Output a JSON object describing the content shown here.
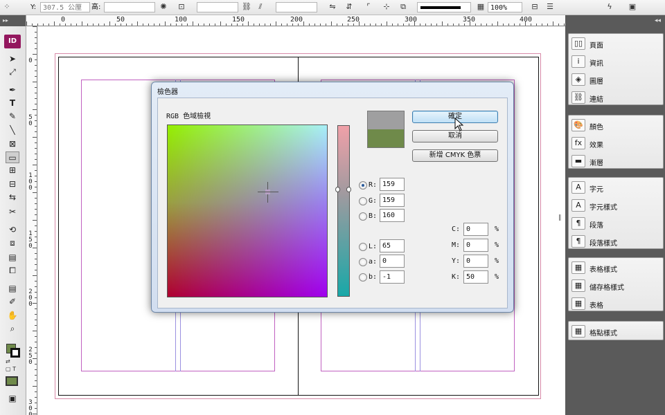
{
  "control_bar": {
    "y_label": "Y:",
    "y_value": "307.5 公厘",
    "height_label": "高:",
    "zoom_value": "100%"
  },
  "tools": {
    "app_badge": "ID",
    "items": [
      "▸",
      "↖",
      "✒",
      "T",
      "╱",
      "＼",
      "⊠",
      "▭",
      "⊞",
      "⊞",
      "⇄",
      "✂",
      "⟲",
      "⬚",
      "▦",
      "▢",
      "✎",
      "✐",
      "✋",
      "🔍"
    ],
    "selected_index": 7
  },
  "ruler": {
    "top_labels": [
      "0",
      "50",
      "100",
      "150",
      "200",
      "250",
      "300",
      "350",
      "400"
    ],
    "left_labels": [
      "0",
      "50",
      "100",
      "150",
      "200",
      "250",
      "300"
    ]
  },
  "panel": {
    "group1": [
      "頁面",
      "資訊",
      "圖層",
      "連結"
    ],
    "group2": [
      "顏色",
      "效果",
      "漸層"
    ],
    "group3": [
      "字元",
      "字元樣式",
      "段落",
      "段落樣式"
    ],
    "group4": [
      "表格樣式",
      "儲存格樣式",
      "表格"
    ],
    "group5": [
      "格點樣式"
    ],
    "icons": {
      "group1": [
        "pages-icon",
        "info-icon",
        "layers-icon",
        "links-icon"
      ],
      "group2": [
        "color-icon",
        "effects-icon",
        "gradient-icon"
      ],
      "group3": [
        "character-icon",
        "character-styles-icon",
        "paragraph-icon",
        "paragraph-styles-icon"
      ],
      "group4": [
        "table-styles-icon",
        "cell-styles-icon",
        "table-icon"
      ],
      "group5": [
        "grid-styles-icon"
      ]
    },
    "glyphs": {
      "group1": [
        "▯▯",
        "i",
        "◈",
        "⛓"
      ],
      "group2": [
        "🎨",
        "fx",
        "▬"
      ],
      "group3": [
        "A",
        "A",
        "¶",
        "¶"
      ],
      "group4": [
        "▦",
        "▦",
        "▦"
      ],
      "group5": [
        "▦"
      ]
    }
  },
  "dialog": {
    "title": "檢色器",
    "section_label": "RGB 色域檢視",
    "buttons": {
      "ok": "確定",
      "cancel": "取消",
      "add_cmyk": "新增 CMYK 色票"
    },
    "rgb": {
      "r_label": "R:",
      "r_value": "159",
      "g_label": "G:",
      "g_value": "159",
      "b_label": "B:",
      "b_value": "160"
    },
    "lab": {
      "l_label": "L:",
      "l_value": "65",
      "a_label": "a:",
      "a_value": "0",
      "b_label": "b:",
      "b_value": "-1"
    },
    "cmyk": {
      "c_label": "C:",
      "c_value": "0",
      "m_label": "M:",
      "m_value": "0",
      "y_label": "Y:",
      "y_value": "0",
      "k_label": "K:",
      "k_value": "50",
      "pct": "%"
    },
    "new_color": "#9f9fa0",
    "old_color": "#6f8a4a",
    "selected_channel": "R"
  },
  "colors": {
    "fill_swatch": "#6f8a4a",
    "app_accent": "#93175e"
  }
}
